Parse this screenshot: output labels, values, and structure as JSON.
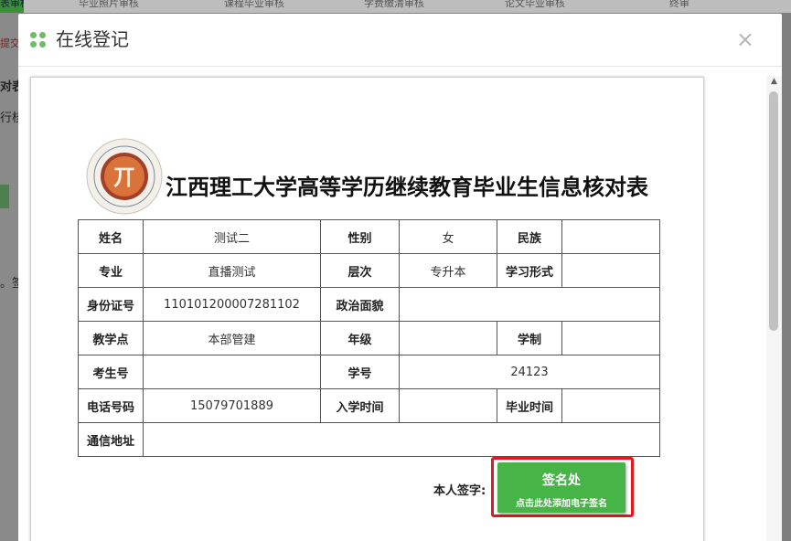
{
  "background": {
    "tabs": [
      "表审核",
      "毕业照片审核",
      "课程毕业审核",
      "学费缴清审核",
      "论文毕业审核",
      "终审"
    ],
    "side_texts": [
      "提交",
      "对表",
      "行核",
      "。签"
    ]
  },
  "modal": {
    "title": "在线登记",
    "close_label": "×",
    "dot_colors": [
      "#6dbd63",
      "#6dbd63",
      "#6dbd63",
      "#6dbd63"
    ]
  },
  "document": {
    "title": "江西理工大学高等学历继续教育毕业生信息核对表",
    "logo_glyph": "丌",
    "rows": [
      [
        {
          "t": "姓名",
          "l": true
        },
        {
          "t": "测试二"
        },
        {
          "t": "性别",
          "l": true
        },
        {
          "t": "女"
        },
        {
          "t": "民族",
          "l": true
        },
        {
          "t": ""
        }
      ],
      [
        {
          "t": "专业",
          "l": true
        },
        {
          "t": "直播测试"
        },
        {
          "t": "层次",
          "l": true
        },
        {
          "t": "专升本"
        },
        {
          "t": "学习形式",
          "l": true
        },
        {
          "t": ""
        }
      ],
      [
        {
          "t": "身份证号",
          "l": true
        },
        {
          "t": "110101200007281102"
        },
        {
          "t": "政治面貌",
          "l": true
        },
        {
          "t": "",
          "span": 3
        }
      ],
      [
        {
          "t": "教学点",
          "l": true
        },
        {
          "t": "本部管建"
        },
        {
          "t": "年级",
          "l": true
        },
        {
          "t": ""
        },
        {
          "t": "学制",
          "l": true
        },
        {
          "t": ""
        }
      ],
      [
        {
          "t": "考生号",
          "l": true
        },
        {
          "t": ""
        },
        {
          "t": "学号",
          "l": true
        },
        {
          "t": "24123",
          "span": 3
        }
      ],
      [
        {
          "t": "电话号码",
          "l": true
        },
        {
          "t": "15079701889"
        },
        {
          "t": "入学时间",
          "l": true
        },
        {
          "t": ""
        },
        {
          "t": "毕业时间",
          "l": true
        },
        {
          "t": ""
        }
      ],
      [
        {
          "t": "通信地址",
          "l": true
        },
        {
          "t": "",
          "span": 5
        }
      ]
    ],
    "signature": {
      "label": "本人签字:",
      "button_line1": "签名处",
      "button_line2": "点击此处添加电子签名"
    }
  },
  "colors": {
    "accent_green": "#47b447",
    "highlight_red": "#e5181d"
  }
}
